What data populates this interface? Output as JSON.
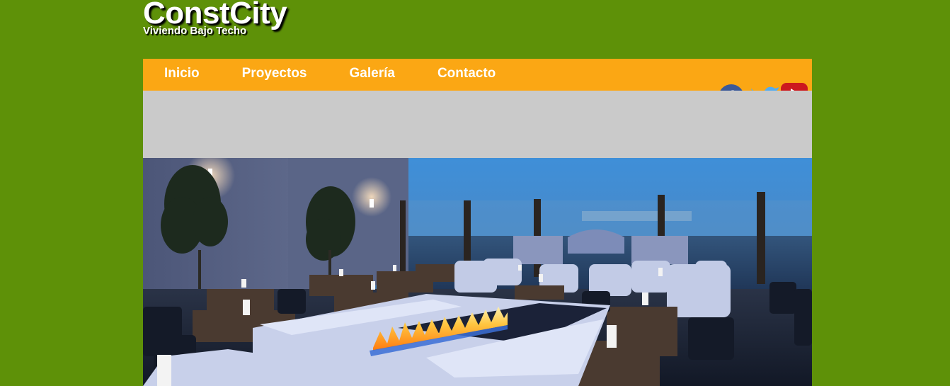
{
  "logo": {
    "title": "ConstCity",
    "subtitle": "Viviendo Bajo Techo"
  },
  "nav": {
    "items": [
      "Inicio",
      "Proyectos",
      "Galería",
      "Contacto"
    ]
  },
  "social": {
    "icons": [
      "facebook-icon",
      "twitter-icon",
      "youtube-icon"
    ]
  },
  "colors": {
    "page_background": "#5e9108",
    "nav_background": "#fba714",
    "banner_background": "#cacaca",
    "nav_text": "#ffffff"
  }
}
